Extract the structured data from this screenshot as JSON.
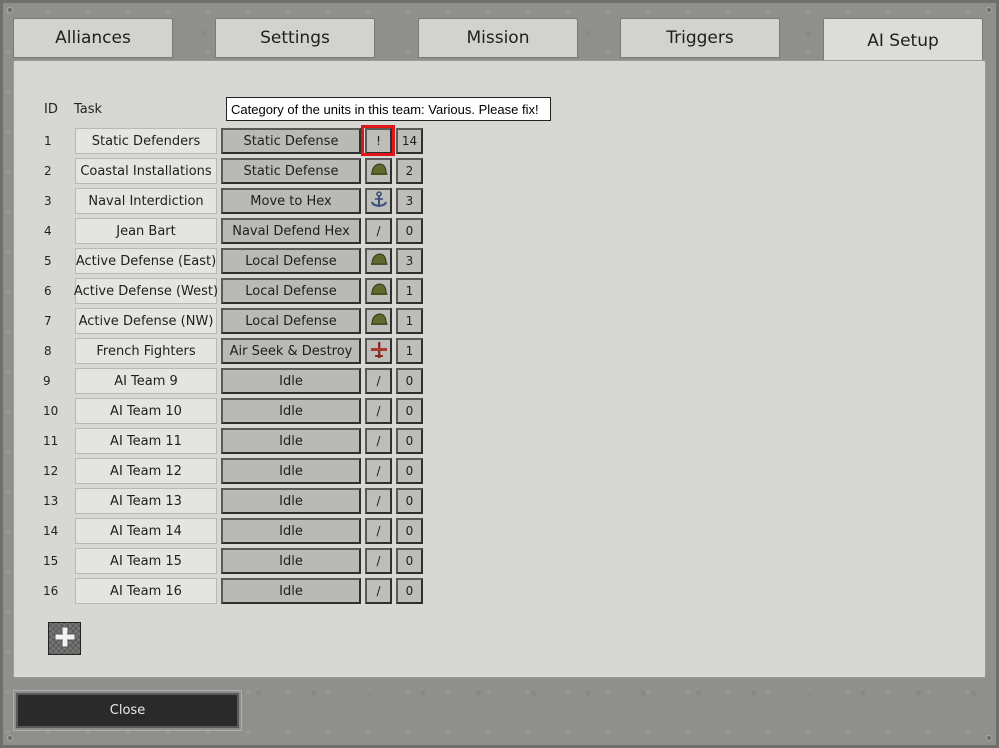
{
  "tabs": [
    {
      "label": "Alliances"
    },
    {
      "label": "Settings"
    },
    {
      "label": "Mission"
    },
    {
      "label": "Triggers"
    },
    {
      "label": "AI Setup"
    }
  ],
  "active_tab": "AI Setup",
  "header": {
    "id": "ID",
    "task": "Task"
  },
  "tooltip": "Category of the units in this team: Various. Please fix!",
  "rows": [
    {
      "id": "1",
      "name": "Static Defenders",
      "task": "Static Defense",
      "category": "warning-icon",
      "category_text": "!",
      "count": "14"
    },
    {
      "id": "2",
      "name": "Coastal Installations",
      "task": "Static Defense",
      "category": "helmet-icon",
      "category_text": "",
      "count": "2"
    },
    {
      "id": "3",
      "name": "Naval Interdiction",
      "task": "Move to Hex",
      "category": "anchor-icon",
      "category_text": "",
      "count": "3"
    },
    {
      "id": "4",
      "name": "Jean Bart",
      "task": "Naval Defend Hex",
      "category": "none",
      "category_text": "/",
      "count": "0"
    },
    {
      "id": "5",
      "name": "Active Defense (East)",
      "task": "Local Defense",
      "category": "helmet-icon",
      "category_text": "",
      "count": "3"
    },
    {
      "id": "6",
      "name": "Active Defense (West)",
      "task": "Local Defense",
      "category": "helmet-icon",
      "category_text": "",
      "count": "1"
    },
    {
      "id": "7",
      "name": "Active Defense (NW)",
      "task": "Local Defense",
      "category": "helmet-icon",
      "category_text": "",
      "count": "1"
    },
    {
      "id": "8",
      "name": "French Fighters",
      "task": "Air Seek & Destroy",
      "category": "plane-icon",
      "category_text": "",
      "count": "1"
    },
    {
      "id": "9",
      "name": "AI Team 9",
      "task": "Idle",
      "category": "none",
      "category_text": "/",
      "count": "0"
    },
    {
      "id": "10",
      "name": "AI Team 10",
      "task": "Idle",
      "category": "none",
      "category_text": "/",
      "count": "0"
    },
    {
      "id": "11",
      "name": "AI Team 11",
      "task": "Idle",
      "category": "none",
      "category_text": "/",
      "count": "0"
    },
    {
      "id": "12",
      "name": "AI Team 12",
      "task": "Idle",
      "category": "none",
      "category_text": "/",
      "count": "0"
    },
    {
      "id": "13",
      "name": "AI Team 13",
      "task": "Idle",
      "category": "none",
      "category_text": "/",
      "count": "0"
    },
    {
      "id": "14",
      "name": "AI Team 14",
      "task": "Idle",
      "category": "none",
      "category_text": "/",
      "count": "0"
    },
    {
      "id": "15",
      "name": "AI Team 15",
      "task": "Idle",
      "category": "none",
      "category_text": "/",
      "count": "0"
    },
    {
      "id": "16",
      "name": "AI Team 16",
      "task": "Idle",
      "category": "none",
      "category_text": "/",
      "count": "0"
    }
  ],
  "add_button_icon": "plus-icon",
  "close_label": "Close",
  "colors": {
    "warning_outline": "#e0161b",
    "helmet": "#5f6a2e",
    "anchor": "#3b4f78",
    "plane": "#8b2a22"
  }
}
